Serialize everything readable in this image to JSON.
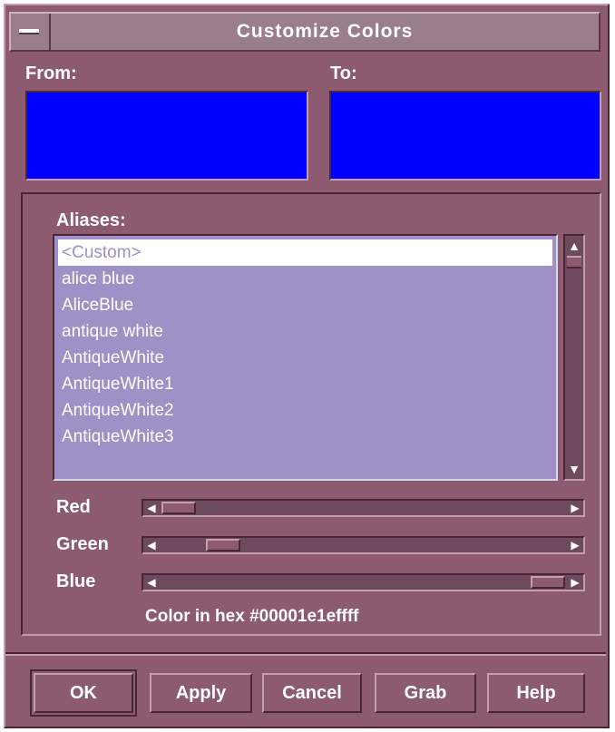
{
  "window": {
    "title": "Customize Colors"
  },
  "from": {
    "label": "From:",
    "color": "#0000ff"
  },
  "to": {
    "label": "To:",
    "color": "#0000ff"
  },
  "aliases": {
    "label": "Aliases:",
    "items": [
      "<Custom>",
      "alice blue",
      "AliceBlue",
      "antique white",
      "AntiqueWhite",
      "AntiqueWhite1",
      "AntiqueWhite2",
      "AntiqueWhite3"
    ],
    "selected_index": 0
  },
  "sliders": {
    "red": {
      "label": "Red",
      "value": 0.0
    },
    "green": {
      "label": "Green",
      "value": 0.12
    },
    "blue": {
      "label": "Blue",
      "value": 1.0
    }
  },
  "hex": {
    "text": "Color in hex #00001e1effff"
  },
  "buttons": {
    "ok": "OK",
    "apply": "Apply",
    "cancel": "Cancel",
    "grab": "Grab",
    "help": "Help"
  },
  "colors": {
    "background": "#8c5b70",
    "list_background": "#9f90c5",
    "swatch": "#0000ff"
  }
}
